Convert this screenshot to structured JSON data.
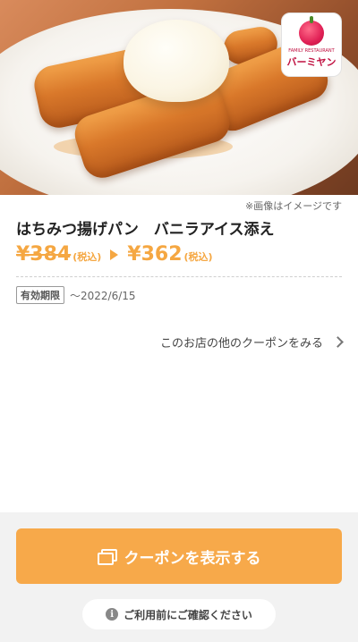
{
  "hero": {
    "logo": {
      "small_text": "FAMILY RESTAURANT",
      "brand_text": "バーミヤン"
    },
    "image_note": "※画像はイメージです"
  },
  "product": {
    "title": "はちみつ揚げパン　バニラアイス添え",
    "original_price": "¥384",
    "original_tax": "(税込)",
    "sale_price": "¥362",
    "sale_tax": "(税込)"
  },
  "validity": {
    "badge": "有効期限",
    "date": "〜2022/6/15"
  },
  "links": {
    "other_coupons": "このお店の他のクーポンをみる"
  },
  "footer": {
    "cta_label": "クーポンを表示する",
    "confirm_label": "ご利用前にご確認ください",
    "info_glyph": "i"
  },
  "colors": {
    "accent": "#f7a94a",
    "price": "#f5a742"
  }
}
